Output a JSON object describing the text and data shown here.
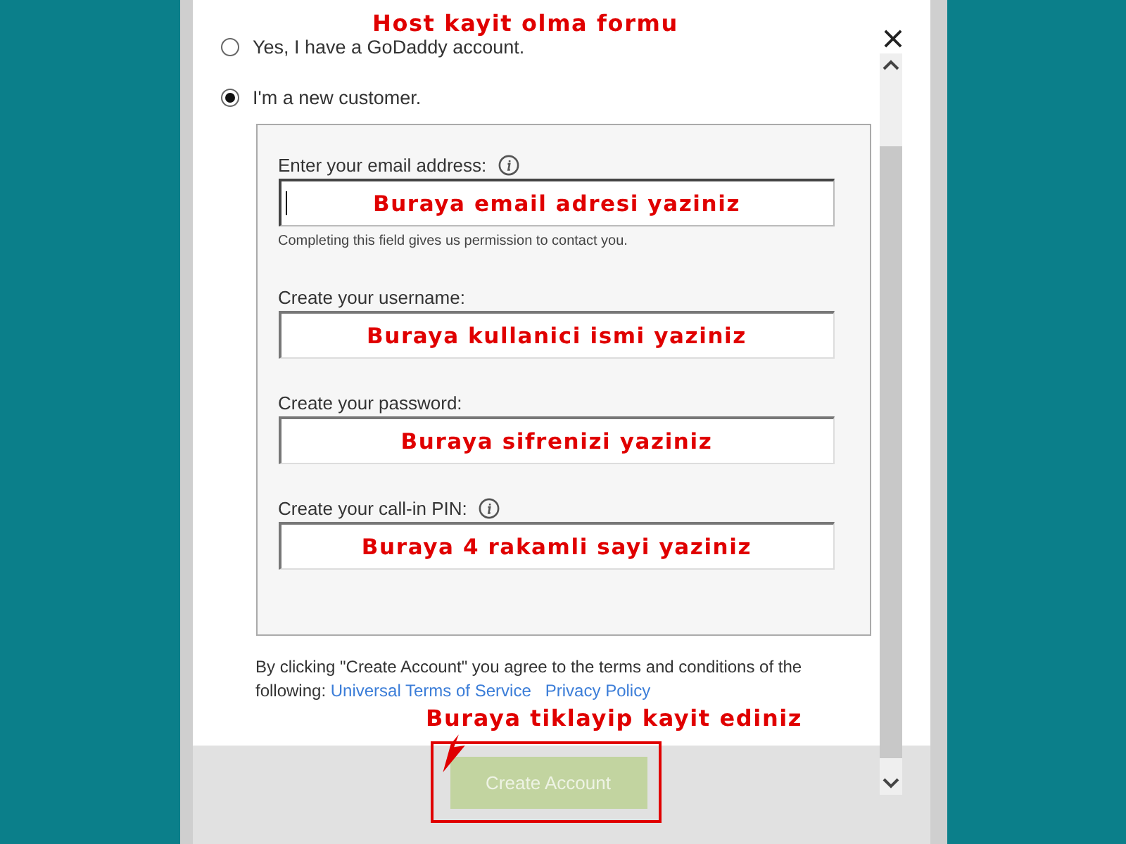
{
  "title_annotation": "Host kayit olma formu",
  "options": [
    {
      "label": "Yes, I have a GoDaddy account.",
      "selected": false
    },
    {
      "label": "I'm a new customer.",
      "selected": true
    }
  ],
  "fields": [
    {
      "label": "Enter your email address:",
      "info": true,
      "value": "Buraya email adresi yaziniz",
      "focused": true,
      "hint": "Completing this field gives us permission to contact you."
    },
    {
      "label": "Create your username:",
      "info": false,
      "value": "Buraya kullanici ismi yaziniz",
      "focused": false
    },
    {
      "label": "Create your password:",
      "info": false,
      "value": "Buraya sifrenizi yaziniz",
      "focused": false
    },
    {
      "label": "Create your call-in PIN:",
      "info": true,
      "value": "Buraya 4 rakamli sayi yaziniz",
      "focused": false
    }
  ],
  "terms": {
    "text": "By clicking \"Create Account\" you agree to the terms and conditions of the following:",
    "links": [
      "Universal Terms of Service",
      "Privacy Policy"
    ]
  },
  "button": {
    "label": "Create Account",
    "disabled": true
  },
  "button_annotation": "Buraya tiklayip kayit ediniz"
}
